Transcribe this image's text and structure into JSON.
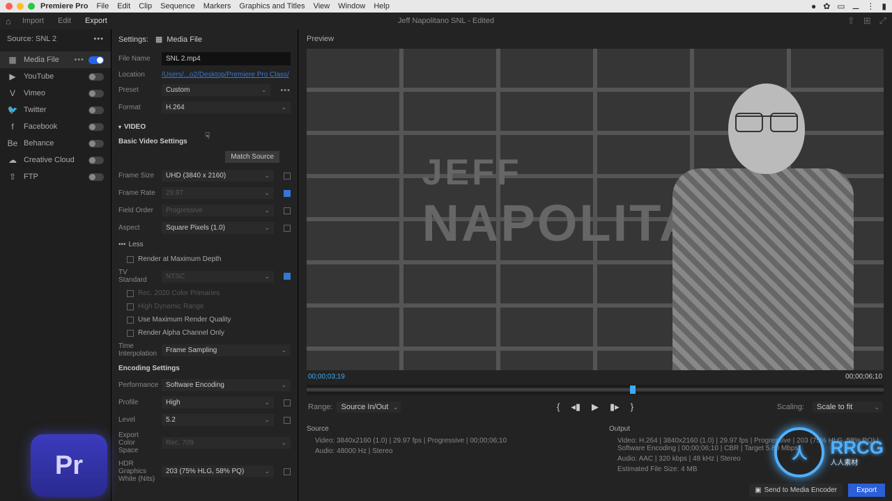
{
  "menu": {
    "app": "Premiere Pro",
    "items": [
      "File",
      "Edit",
      "Clip",
      "Sequence",
      "Markers",
      "Graphics and Titles",
      "View",
      "Window",
      "Help"
    ]
  },
  "window_title": "Jeff Napolitano SNL - Edited",
  "top_tabs": {
    "home_icon": "⌂",
    "import": "Import",
    "edit": "Edit",
    "export": "Export"
  },
  "source": {
    "label": "Source:",
    "name": "SNL 2"
  },
  "destinations": [
    {
      "icon": "▦",
      "label": "Media File",
      "on": true,
      "dots": true
    },
    {
      "icon": "▶",
      "label": "YouTube",
      "on": false
    },
    {
      "icon": "V",
      "label": "Vimeo",
      "on": false
    },
    {
      "icon": "🐦",
      "label": "Twitter",
      "on": false
    },
    {
      "icon": "f",
      "label": "Facebook",
      "on": false
    },
    {
      "icon": "Be",
      "label": "Behance",
      "on": false
    },
    {
      "icon": "☁",
      "label": "Creative Cloud",
      "on": false
    },
    {
      "icon": "⇧",
      "label": "FTP",
      "on": false
    }
  ],
  "settings": {
    "header": "Settings:",
    "media_file": "Media File",
    "file_name_label": "File Name",
    "file_name": "SNL 2.mp4",
    "location_label": "Location",
    "location": "/Users/...o2/Desktop/Premiere Pro Class/",
    "preset_label": "Preset",
    "preset": "Custom",
    "format_label": "Format",
    "format": "H.264"
  },
  "video": {
    "section": "VIDEO",
    "basic": "Basic Video Settings",
    "match_source": "Match Source",
    "frame_size_label": "Frame Size",
    "frame_size": "UHD (3840 x 2160)",
    "frame_rate_label": "Frame Rate",
    "frame_rate": "29.97",
    "field_order_label": "Field Order",
    "field_order": "Progressive",
    "aspect_label": "Aspect",
    "aspect": "Square Pixels (1.0)",
    "less": "Less",
    "render_max_depth": "Render at Maximum Depth",
    "tv_standard_label": "TV Standard",
    "tv_standard": "NTSC",
    "rec2020": "Rec. 2020 Color Primaries",
    "hdr": "High Dynamic Range",
    "max_quality": "Use Maximum Render Quality",
    "alpha_only": "Render Alpha Channel Only",
    "time_interp_label": "Time Interpolation",
    "time_interp": "Frame Sampling"
  },
  "encoding": {
    "header": "Encoding Settings",
    "performance_label": "Performance",
    "performance": "Software Encoding",
    "profile_label": "Profile",
    "profile": "High",
    "level_label": "Level",
    "level": "5.2",
    "export_color_label": "Export Color Space",
    "export_color": "Rec. 709",
    "hdr_white_label": "HDR Graphics White (Nits)",
    "hdr_white": "203 (75% HLG, 58% PQ)"
  },
  "preview": {
    "header": "Preview",
    "first_name": "JEFF",
    "last_name": "NAPOLITANO",
    "cur_time": "00;00;03;19",
    "total_time": "00;00;06;10",
    "range_label": "Range:",
    "range": "Source In/Out",
    "scaling_label": "Scaling:",
    "scaling": "Scale to fit"
  },
  "source_info": {
    "header": "Source",
    "video_label": "Video:",
    "video": "3840x2160 (1.0) | 29.97 fps | Progressive | 00;00;06;10",
    "audio_label": "Audio:",
    "audio": "48000 Hz | Stereo"
  },
  "output_info": {
    "header": "Output",
    "video_label": "Video:",
    "video": "H.264 | 3840x2160 (1.0) | 29.97 fps | Progressive | 203 (75% HLG, 58% PQ) | Software Encoding | 00;00;06;10 | CBR | Target 5.80 Mbps",
    "audio_label": "Audio:",
    "audio": "AAC | 320 kbps | 48 kHz | Stereo",
    "size_label": "Estimated File Size:",
    "size": "4 MB"
  },
  "actions": {
    "send_me": "Send to Media Encoder",
    "export": "Export"
  },
  "logos": {
    "pr": "Pr",
    "rrcg": "RRCG",
    "rrcg_sub": "人人素材"
  }
}
